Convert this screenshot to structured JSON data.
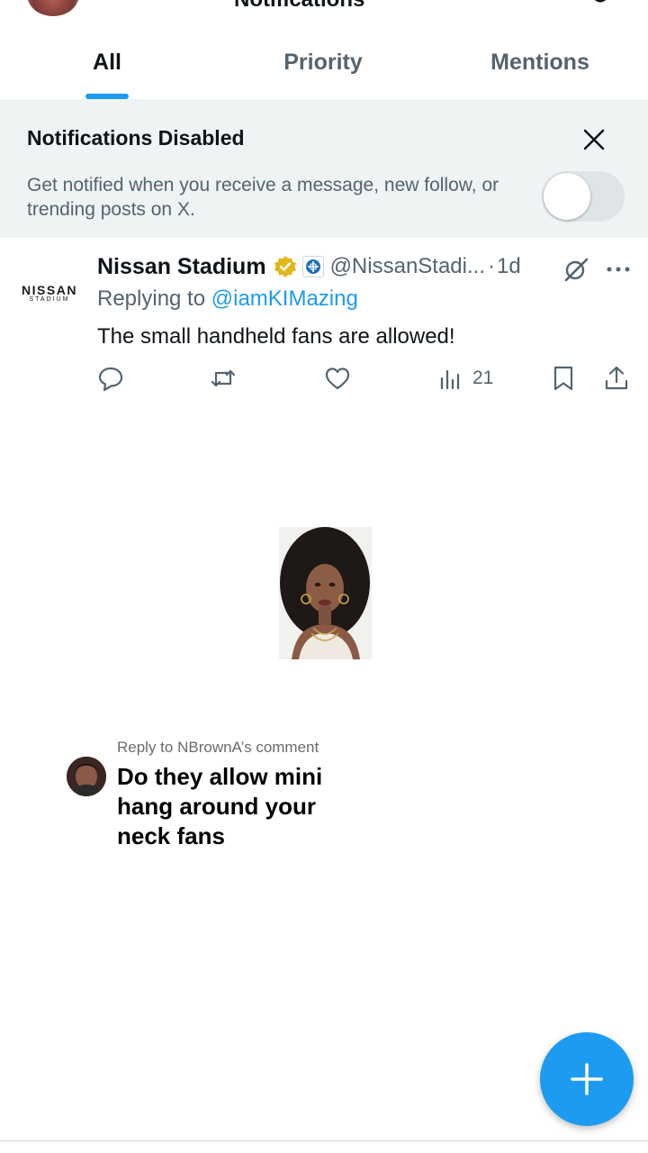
{
  "header": {
    "title": "Notifications"
  },
  "tabs": [
    {
      "label": "All",
      "active": true
    },
    {
      "label": "Priority",
      "active": false
    },
    {
      "label": "Mentions",
      "active": false
    }
  ],
  "banner": {
    "title": "Notifications Disabled",
    "body": "Get notified when you receive a message, new follow, or trending posts on X.",
    "toggle_on": false
  },
  "tweet": {
    "logo_text": "NISSAN",
    "logo_subtext": "STADIUM",
    "author": "Nissan Stadium",
    "handle": "@NissanStadi...",
    "separator": "·",
    "time": "1d",
    "replying_prefix": "Replying to",
    "replying_to": "@iamKIMazing",
    "text": "The small handheld fans are allowed!",
    "views": "21"
  },
  "comment": {
    "label": "Reply to NBrownA’s comment",
    "text": "Do they allow mini hang around your neck fans"
  },
  "icons": {
    "verified": "verified-badge-icon",
    "affiliation": "affiliate-badge-icon",
    "grok": "grok-icon",
    "more": "more-dots-icon",
    "reply": "reply-icon",
    "retweet": "retweet-icon",
    "like": "heart-icon",
    "views": "views-chart-icon",
    "bookmark": "bookmark-icon",
    "share": "share-icon",
    "compose": "plus-icon"
  },
  "colors": {
    "accent": "#1d9bf0",
    "verified": "#e2b719",
    "banner_bg": "#eff3f4",
    "secondary_text": "#536471"
  }
}
